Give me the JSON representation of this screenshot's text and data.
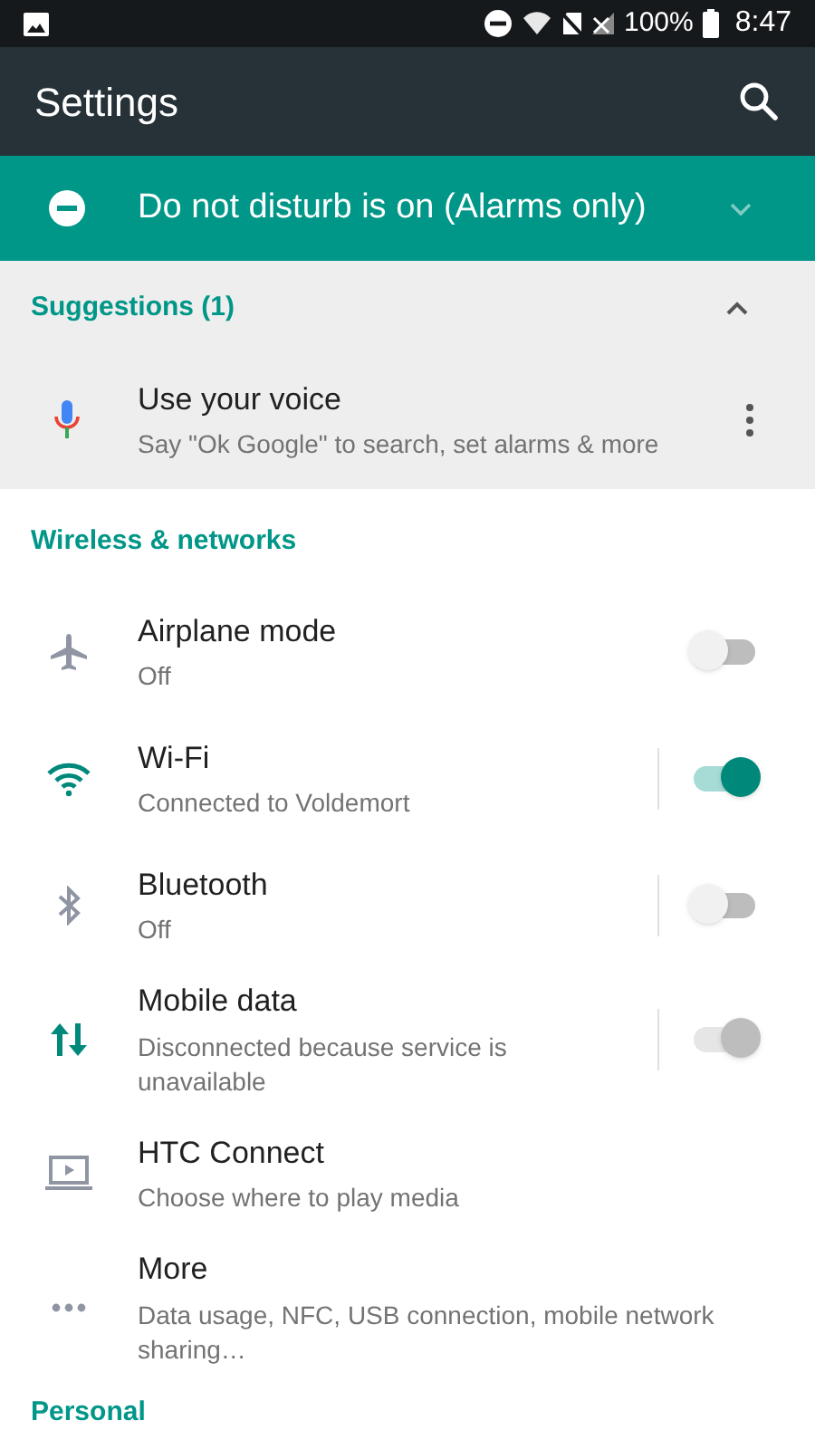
{
  "status_bar": {
    "battery": "100%",
    "time": "8:47"
  },
  "toolbar": {
    "title": "Settings"
  },
  "dnd_banner": {
    "text": "Do not disturb is on (Alarms only)",
    "expanded": false
  },
  "suggestions": {
    "title": "Suggestions (1)",
    "expanded": true,
    "items": [
      {
        "title": "Use your voice",
        "subtitle": "Say \"Ok Google\" to search, set alarms & more"
      }
    ]
  },
  "sections": [
    {
      "title": "Wireless & networks",
      "items": [
        {
          "kind": "toggle",
          "title": "Airplane mode",
          "subtitle": "Off",
          "on": false,
          "disabled": false,
          "divider": false
        },
        {
          "kind": "toggle",
          "title": "Wi-Fi",
          "subtitle": "Connected to Voldemort",
          "on": true,
          "disabled": false,
          "divider": true
        },
        {
          "kind": "toggle",
          "title": "Bluetooth",
          "subtitle": "Off",
          "on": false,
          "disabled": false,
          "divider": true
        },
        {
          "kind": "toggle",
          "title": "Mobile data",
          "subtitle": "Disconnected because service is unavailable",
          "on": true,
          "disabled": true,
          "divider": true
        },
        {
          "kind": "link",
          "title": "HTC Connect",
          "subtitle": "Choose where to play media"
        },
        {
          "kind": "link",
          "title": "More",
          "subtitle": "Data usage, NFC, USB connection, mobile network sharing…"
        }
      ]
    },
    {
      "title": "Personal"
    }
  ]
}
